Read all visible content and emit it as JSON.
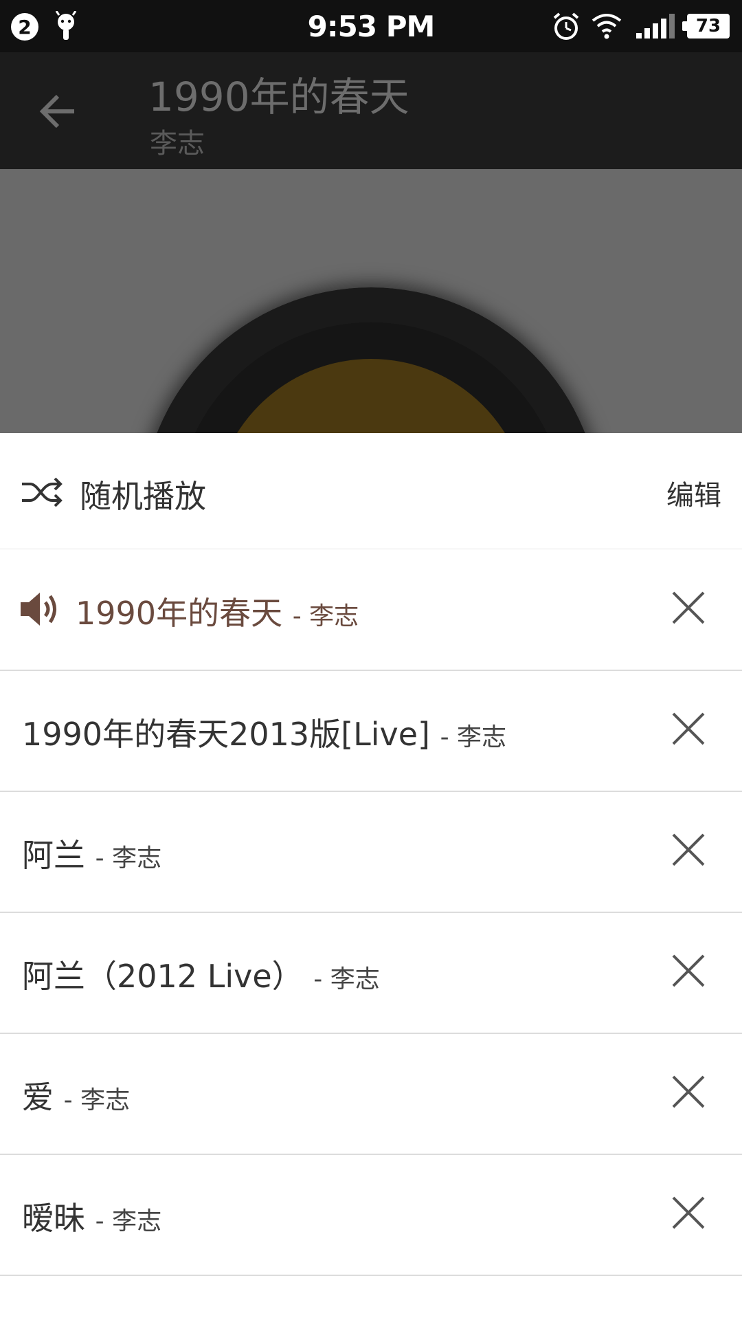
{
  "status_bar": {
    "notification_count": "2",
    "time": "9:53 PM",
    "battery": "73"
  },
  "header": {
    "title": "1990年的春天",
    "artist": "李志"
  },
  "sheet": {
    "shuffle_label": "随机播放",
    "edit_label": "编辑",
    "playing_color": "#6a4a3e",
    "tracks": [
      {
        "title": "1990年的春天",
        "artist": "李志",
        "playing": true
      },
      {
        "title": "1990年的春天2013版[Live]",
        "artist": "李志",
        "playing": false
      },
      {
        "title": "阿兰",
        "artist": "李志",
        "playing": false
      },
      {
        "title": "阿兰（2012 Live）",
        "artist": "李志",
        "playing": false
      },
      {
        "title": "爱",
        "artist": "李志",
        "playing": false
      },
      {
        "title": "暧昧",
        "artist": "李志",
        "playing": false
      }
    ]
  }
}
